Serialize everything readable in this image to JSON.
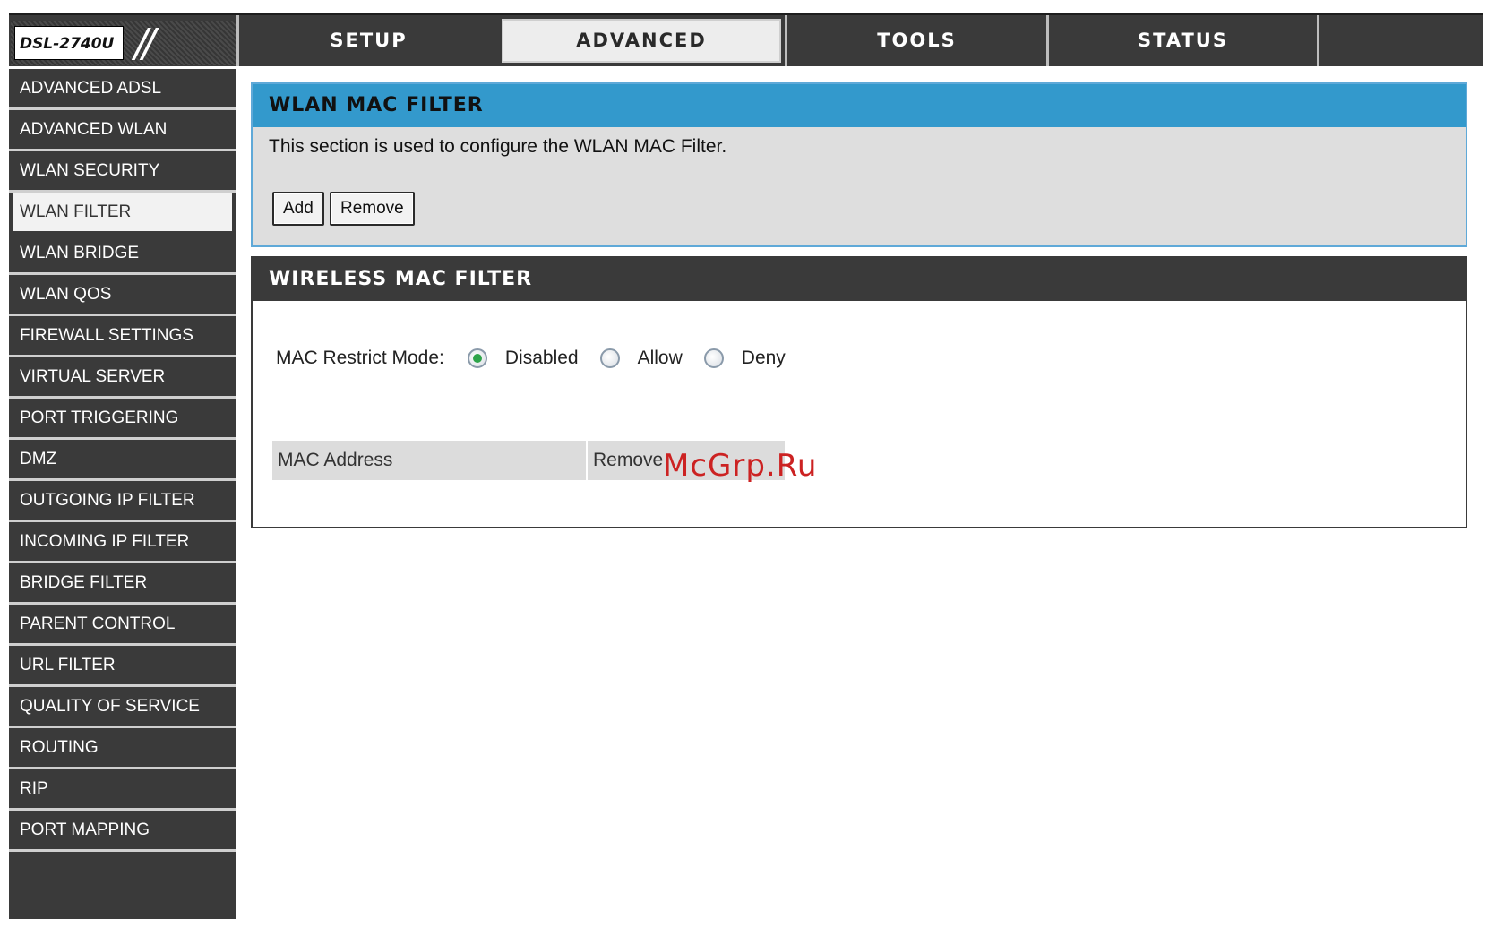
{
  "logo": {
    "model": "DSL-2740U",
    "slashes": "//"
  },
  "tabs": [
    {
      "label": "SETUP",
      "active": false
    },
    {
      "label": "ADVANCED",
      "active": true
    },
    {
      "label": "TOOLS",
      "active": false
    },
    {
      "label": "STATUS",
      "active": false
    },
    {
      "label": "",
      "active": false
    }
  ],
  "sidebar": {
    "items": [
      {
        "label": "ADVANCED ADSL",
        "active": false
      },
      {
        "label": "ADVANCED WLAN",
        "active": false
      },
      {
        "label": "WLAN SECURITY",
        "active": false
      },
      {
        "label": "WLAN FILTER",
        "active": true
      },
      {
        "label": "WLAN BRIDGE",
        "active": false
      },
      {
        "label": "WLAN QOS",
        "active": false
      },
      {
        "label": "FIREWALL SETTINGS",
        "active": false
      },
      {
        "label": "VIRTUAL SERVER",
        "active": false
      },
      {
        "label": "PORT TRIGGERING",
        "active": false
      },
      {
        "label": "DMZ",
        "active": false
      },
      {
        "label": "OUTGOING IP FILTER",
        "active": false
      },
      {
        "label": "INCOMING IP FILTER",
        "active": false
      },
      {
        "label": "BRIDGE FILTER",
        "active": false
      },
      {
        "label": "PARENT CONTROL",
        "active": false
      },
      {
        "label": "URL FILTER",
        "active": false
      },
      {
        "label": "QUALITY OF SERVICE",
        "active": false
      },
      {
        "label": "ROUTING",
        "active": false
      },
      {
        "label": "RIP",
        "active": false
      },
      {
        "label": "PORT MAPPING",
        "active": false
      }
    ]
  },
  "wlan_filter": {
    "title": "WLAN MAC FILTER",
    "description": "This section is used to configure the WLAN MAC Filter.",
    "add_label": "Add",
    "remove_label": "Remove"
  },
  "wireless_filter": {
    "title": "WIRELESS MAC FILTER",
    "mode_label": "MAC Restrict Mode:",
    "options": [
      {
        "label": "Disabled",
        "checked": true
      },
      {
        "label": "Allow",
        "checked": false
      },
      {
        "label": "Deny",
        "checked": false
      }
    ],
    "table_headers": [
      "MAC Address",
      "Remove"
    ]
  },
  "watermark": "McGrp.Ru",
  "colors": {
    "dark": "#3a3a3a",
    "accent_blue": "#3399cc",
    "panel_gray": "#dedede",
    "radio_checked": "#2ea44a",
    "watermark": "#cc2222"
  }
}
